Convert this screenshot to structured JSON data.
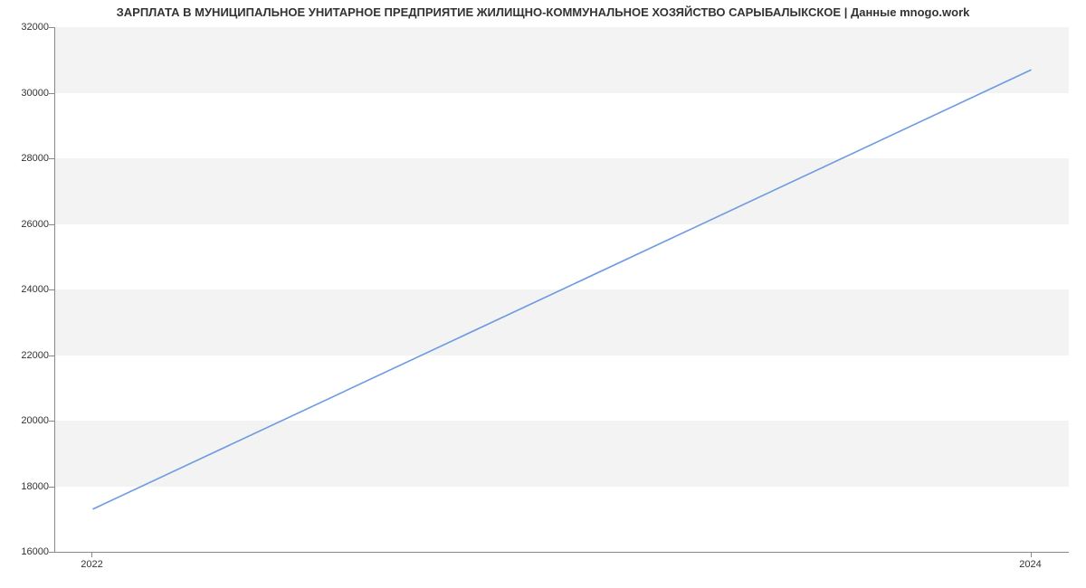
{
  "chart_data": {
    "type": "line",
    "title": "ЗАРПЛАТА В МУНИЦИПАЛЬНОЕ УНИТАРНОЕ ПРЕДПРИЯТИЕ ЖИЛИЩНО-КОММУНАЛЬНОЕ ХОЗЯЙСТВО САРЫБАЛЫКСКОЕ | Данные mnogo.work",
    "xlabel": "",
    "ylabel": "",
    "x": [
      2022,
      2024
    ],
    "values": [
      17300,
      30700
    ],
    "xlim": [
      2021.92,
      2024.08
    ],
    "ylim": [
      16000,
      32000
    ],
    "y_ticks": [
      16000,
      18000,
      20000,
      22000,
      24000,
      26000,
      28000,
      30000,
      32000
    ],
    "x_ticks": [
      2022,
      2024
    ],
    "line_color": "#6d9ae2",
    "band_color": "#f3f3f3"
  }
}
